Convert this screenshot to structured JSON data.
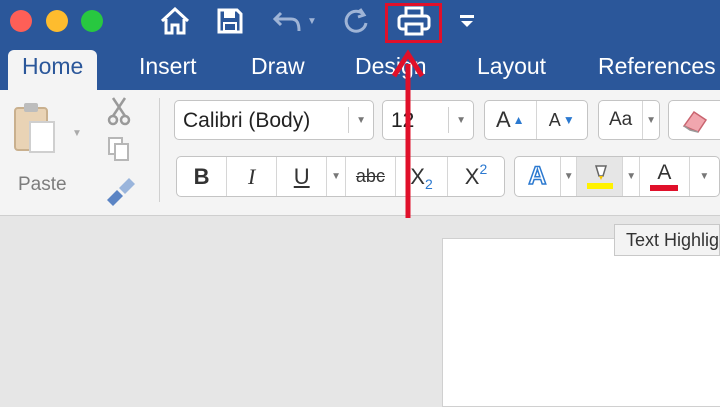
{
  "window": {
    "traffic_lights": [
      {
        "name": "close",
        "color": "#fe5f57"
      },
      {
        "name": "minimize",
        "color": "#febc2e"
      },
      {
        "name": "maximize",
        "color": "#28c840"
      }
    ]
  },
  "quick_access": [
    "home-icon",
    "save-icon",
    "undo-icon",
    "redo-icon",
    "print-icon",
    "customize-icon"
  ],
  "tabs": [
    "Home",
    "Insert",
    "Draw",
    "Design",
    "Layout",
    "References"
  ],
  "clipboard": {
    "paste_label": "Paste"
  },
  "font": {
    "name": "Calibri (Body)",
    "size": "12"
  },
  "format_buttons": {
    "bold": "B",
    "italic": "I",
    "underline": "U",
    "strike": "abc",
    "subscript": "X",
    "superscript": "X",
    "sub_digit": "2",
    "sup_digit": "2"
  },
  "size_buttons": {
    "grow": "A",
    "shrink": "A",
    "change_case": "Aa"
  },
  "effects": {
    "text_effect": "A",
    "font_color": "A"
  },
  "tooltip": {
    "text": "Text Highlight Color"
  },
  "colors": {
    "ribbon_blue": "#2b579a",
    "annotation_red": "#e0102a",
    "highlight_yellow": "#fff200",
    "font_color_red": "#e0102a"
  }
}
